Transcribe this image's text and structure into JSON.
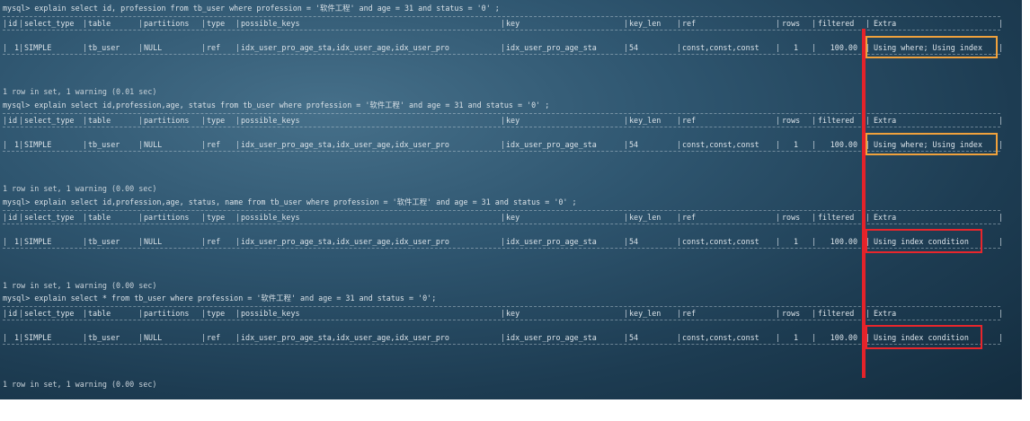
{
  "queries": [
    {
      "command": "mysql> explain select id, profession from tb_user where profession = '软件工程' and age = 31 and status = '0' ;",
      "summary": "1 row in set, 1 warning (0.01 sec)",
      "extra_highlight": "#f0a13c",
      "row": {
        "id": "1",
        "select_type": "SIMPLE",
        "table": "tb_user",
        "partitions": "NULL",
        "type": "ref",
        "possible_keys": "idx_user_pro_age_sta,idx_user_age,idx_user_pro",
        "key": "idx_user_pro_age_sta",
        "key_len": "54",
        "ref": "const,const,const",
        "rows": "1",
        "filtered": "100.00",
        "extra": "Using where; Using index"
      }
    },
    {
      "command": "mysql> explain select id,profession,age, status from tb_user where profession = '软件工程' and age = 31 and status = '0' ;",
      "summary": "1 row in set, 1 warning (0.00 sec)",
      "extra_highlight": "#f0a13c",
      "row": {
        "id": "1",
        "select_type": "SIMPLE",
        "table": "tb_user",
        "partitions": "NULL",
        "type": "ref",
        "possible_keys": "idx_user_pro_age_sta,idx_user_age,idx_user_pro",
        "key": "idx_user_pro_age_sta",
        "key_len": "54",
        "ref": "const,const,const",
        "rows": "1",
        "filtered": "100.00",
        "extra": "Using where; Using index"
      }
    },
    {
      "command": "mysql> explain select id,profession,age, status, name from tb_user where profession = '软件工程' and age = 31 and status = '0' ;",
      "summary": "1 row in set, 1 warning (0.00 sec)",
      "extra_highlight": "#e8262c",
      "row": {
        "id": "1",
        "select_type": "SIMPLE",
        "table": "tb_user",
        "partitions": "NULL",
        "type": "ref",
        "possible_keys": "idx_user_pro_age_sta,idx_user_age,idx_user_pro",
        "key": "idx_user_pro_age_sta",
        "key_len": "54",
        "ref": "const,const,const",
        "rows": "1",
        "filtered": "100.00",
        "extra": "Using index condition"
      }
    },
    {
      "command": "mysql> explain select * from tb_user where profession = '软件工程' and age = 31 and status = '0';",
      "summary": "1 row in set, 1 warning (0.00 sec)",
      "extra_highlight": "#e8262c",
      "row": {
        "id": "1",
        "select_type": "SIMPLE",
        "table": "tb_user",
        "partitions": "NULL",
        "type": "ref",
        "possible_keys": "idx_user_pro_age_sta,idx_user_age,idx_user_pro",
        "key": "idx_user_pro_age_sta",
        "key_len": "54",
        "ref": "const,const,const",
        "rows": "1",
        "filtered": "100.00",
        "extra": "Using index condition"
      }
    }
  ],
  "columns": {
    "id": "id",
    "select_type": "select_type",
    "table": "table",
    "partitions": "partitions",
    "type": "type",
    "possible_keys": "possible_keys",
    "key": "key",
    "key_len": "key_len",
    "ref": "ref",
    "rows": "rows",
    "filtered": "filtered",
    "extra": "Extra"
  },
  "annotation_color": "#e4232a",
  "terminal_background": "#2f5670"
}
